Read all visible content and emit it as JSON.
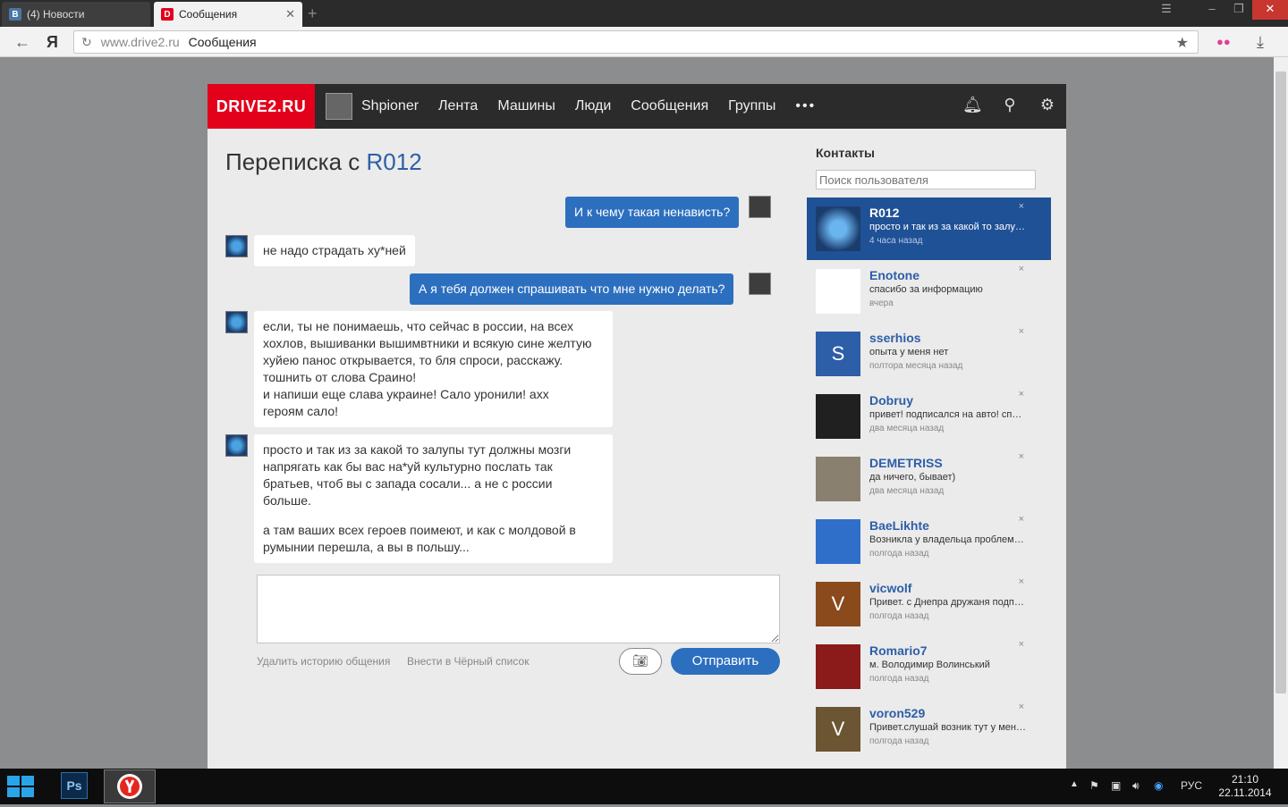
{
  "browser": {
    "tabs": [
      {
        "label": "(4) Новости",
        "favicon": "В"
      },
      {
        "label": "Сообщения",
        "favicon": "D"
      }
    ],
    "url_domain": "www.drive2.ru",
    "url_title": "Сообщения",
    "yandex_glyph": "Я"
  },
  "site": {
    "logo": "DRIVE2.RU",
    "username": "Shpioner",
    "nav": [
      "Лента",
      "Машины",
      "Люди",
      "Сообщения",
      "Группы"
    ],
    "more": "•••"
  },
  "conversation": {
    "title_prefix": "Переписка с ",
    "partner": "R012",
    "messages": [
      {
        "dir": "out",
        "lines": [
          "И к чему такая ненависть?"
        ]
      },
      {
        "dir": "in",
        "lines": [
          "не надо страдать ху*ней"
        ]
      },
      {
        "dir": "out",
        "lines": [
          "А я тебя должен спрашивать что мне нужно делать?"
        ]
      },
      {
        "dir": "in",
        "lines": [
          "если, ты не понимаешь, что сейчас в россии, на всех",
          "хохлов, вышиванки вышимвтники и всякую сине желтую",
          "хуйею панос открывается, то бля спроси, расскажу.",
          "тошнить от слова Сраино!",
          "и напиши еще слава украине! Сало уронили! ахх",
          "героям сало!"
        ]
      },
      {
        "dir": "in",
        "lines": [
          "просто и так из за какой то залупы тут должны мозги",
          "напрягать как бы вас на*уй культурно послать так",
          "братьев, чтоб вы с запада сосали... а не с россии",
          "больше."
        ]
      },
      {
        "dir": "in",
        "lines": [
          "а там ваших всех героев поимеют, и как с молдовой в",
          "румынии перешла, а вы в польшу..."
        ]
      }
    ],
    "delete_history": "Удалить историю общения",
    "blacklist": "Внести в Чёрный список",
    "send": "Отправить"
  },
  "contacts": {
    "title": "Контакты",
    "search_placeholder": "Поиск пользователя",
    "items": [
      {
        "name": "R012",
        "msg": "просто и так из за какой то залупы тут должны мозги",
        "time": "4 часа назад",
        "selected": true,
        "avatar_letter": "",
        "avatar_color": "#3a7fc1"
      },
      {
        "name": "Enotone",
        "msg": "спасибо за информацию",
        "time": "вчера",
        "selected": false,
        "avatar_letter": "",
        "avatar_color": "#ffffff"
      },
      {
        "name": "sserhios",
        "msg": "опыта у меня нет",
        "time": "полтора месяца назад",
        "selected": false,
        "avatar_letter": "S",
        "avatar_color": "#2d5ea8"
      },
      {
        "name": "Dobruy",
        "msg": "привет! подписался на авто! спасибо",
        "time": "два месяца назад",
        "selected": false,
        "avatar_letter": "",
        "avatar_color": "#202020"
      },
      {
        "name": "DEMETRISS",
        "msg": "да ничего, бывает)",
        "time": "два месяца назад",
        "selected": false,
        "avatar_letter": "",
        "avatar_color": "#8a8070"
      },
      {
        "name": "BaeLikhte",
        "msg": "Возникла у владельца проблема с авто",
        "time": "полгода назад",
        "selected": false,
        "avatar_letter": "",
        "avatar_color": "#2f6fc9"
      },
      {
        "name": "vicwolf",
        "msg": "Привет. с Днепра дружаня подписался",
        "time": "полгода назад",
        "selected": false,
        "avatar_letter": "V",
        "avatar_color": "#8b4a1c"
      },
      {
        "name": "Romario7",
        "msg": "м. Володимир Волинський",
        "time": "полгода назад",
        "selected": false,
        "avatar_letter": "",
        "avatar_color": "#8b1a1a"
      },
      {
        "name": "voron529",
        "msg": "Привет.слушай возник тут у меня вопрос",
        "time": "полгода назад",
        "selected": false,
        "avatar_letter": "V",
        "avatar_color": "#6b5533"
      }
    ]
  },
  "taskbar": {
    "lang": "РУС",
    "time": "21:10",
    "date": "22.11.2014",
    "ps": "Ps"
  },
  "colors": {
    "brand_red": "#e3001b",
    "accent_blue": "#2d6fbf",
    "link_blue": "#2d5ea8"
  }
}
